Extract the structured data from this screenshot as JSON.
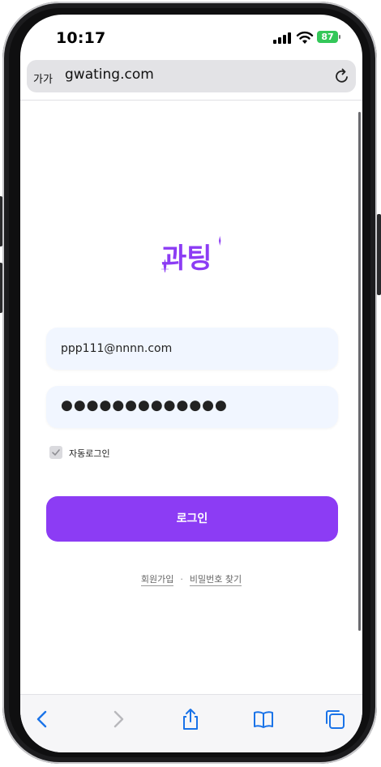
{
  "status_bar": {
    "time": "10:17",
    "battery": "87"
  },
  "browser": {
    "text_size_button": "가가",
    "url": "gwating.com"
  },
  "logo": {
    "text": "과팅"
  },
  "login_form": {
    "email_value": "ppp111@nnnn.com",
    "password_masked": "●●●●●●●●●●●●●",
    "auto_login_label": "자동로그인",
    "auto_login_checked": true,
    "login_button": "로그인"
  },
  "footer_links": {
    "signup": "회원가입",
    "separator": "·",
    "find_password": "비밀번호 찾기"
  },
  "colors": {
    "accent": "#8c3cf4",
    "field_bg": "#f1f6ff",
    "toolbar_icon": "#1a73e8"
  },
  "toolbar": {
    "icons": [
      "back-icon",
      "forward-icon",
      "share-icon",
      "bookmarks-icon",
      "tabs-icon"
    ]
  }
}
